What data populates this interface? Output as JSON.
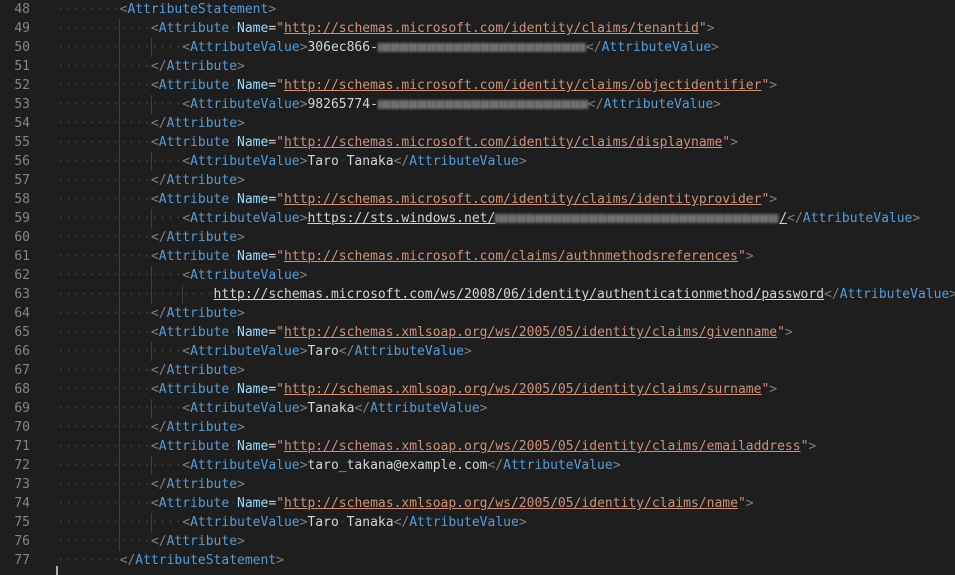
{
  "editor": {
    "tag_attribute_statement": "AttributeStatement",
    "tag_attribute": "Attribute",
    "tag_attribute_value": "AttributeValue",
    "attr_name": "Name"
  },
  "lines": [
    {
      "n": "48",
      "kind": "open_stmt"
    },
    {
      "n": "49",
      "kind": "attr_open",
      "value": "http://schemas.microsoft.com/identity/claims/tenantid"
    },
    {
      "n": "50",
      "kind": "value",
      "text": "306ec866-",
      "redacted": true
    },
    {
      "n": "51",
      "kind": "attr_close"
    },
    {
      "n": "52",
      "kind": "attr_open",
      "value": "http://schemas.microsoft.com/identity/claims/objectidentifier"
    },
    {
      "n": "53",
      "kind": "value",
      "text": "98265774-",
      "redacted": true
    },
    {
      "n": "54",
      "kind": "attr_close"
    },
    {
      "n": "55",
      "kind": "attr_open",
      "value": "http://schemas.microsoft.com/identity/claims/displayname"
    },
    {
      "n": "56",
      "kind": "value",
      "text": "Taro Tanaka"
    },
    {
      "n": "57",
      "kind": "attr_close"
    },
    {
      "n": "58",
      "kind": "attr_open",
      "value": "http://schemas.microsoft.com/identity/claims/identityprovider"
    },
    {
      "n": "59",
      "kind": "value_link",
      "text": "https://sts.windows.net/",
      "suffix": "/",
      "redacted": true
    },
    {
      "n": "60",
      "kind": "attr_close"
    },
    {
      "n": "61",
      "kind": "attr_open",
      "value": "http://schemas.microsoft.com/claims/authnmethodsreferences"
    },
    {
      "n": "62",
      "kind": "value_open"
    },
    {
      "n": "63",
      "kind": "value_cont",
      "text": "http://schemas.microsoft.com/ws/2008/06/identity/authenticationmethod/password"
    },
    {
      "n": "64",
      "kind": "attr_close"
    },
    {
      "n": "65",
      "kind": "attr_open",
      "value": "http://schemas.xmlsoap.org/ws/2005/05/identity/claims/givenname"
    },
    {
      "n": "66",
      "kind": "value",
      "text": "Taro"
    },
    {
      "n": "67",
      "kind": "attr_close"
    },
    {
      "n": "68",
      "kind": "attr_open",
      "value": "http://schemas.xmlsoap.org/ws/2005/05/identity/claims/surname"
    },
    {
      "n": "69",
      "kind": "value",
      "text": "Tanaka"
    },
    {
      "n": "70",
      "kind": "attr_close"
    },
    {
      "n": "71",
      "kind": "attr_open",
      "value": "http://schemas.xmlsoap.org/ws/2005/05/identity/claims/emailaddress"
    },
    {
      "n": "72",
      "kind": "value",
      "text": "taro_takana@example.com"
    },
    {
      "n": "73",
      "kind": "attr_close"
    },
    {
      "n": "74",
      "kind": "attr_open",
      "value": "http://schemas.xmlsoap.org/ws/2005/05/identity/claims/name"
    },
    {
      "n": "75",
      "kind": "value",
      "text": "Taro Tanaka"
    },
    {
      "n": "76",
      "kind": "attr_close"
    },
    {
      "n": "77",
      "kind": "close_stmt"
    }
  ]
}
